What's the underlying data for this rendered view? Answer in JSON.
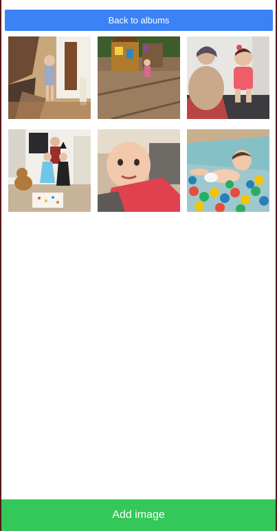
{
  "header": {
    "back_label": "Back to albums"
  },
  "footer": {
    "add_label": "Add image"
  },
  "colors": {
    "back_button": "#3b82f6",
    "add_button": "#34c759",
    "page_edge": "#5a1316"
  },
  "photos": [
    {
      "name": "photo-girl-hallway"
    },
    {
      "name": "photo-backyard-playhouse"
    },
    {
      "name": "photo-grandmother-baby"
    },
    {
      "name": "photo-kids-costumes"
    },
    {
      "name": "photo-baby-closeup"
    },
    {
      "name": "photo-baby-ball-pit"
    }
  ]
}
